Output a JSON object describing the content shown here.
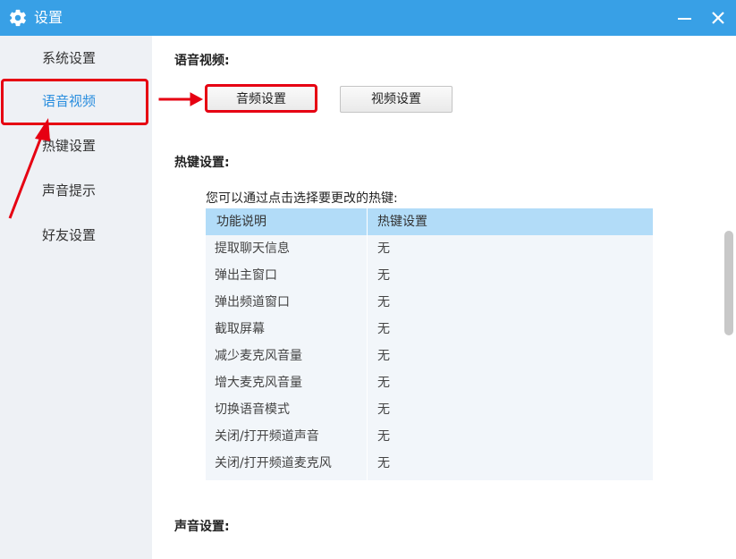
{
  "window": {
    "title": "设置",
    "title_bar_color": "#38a0e6"
  },
  "sidebar": {
    "items": [
      {
        "label": "系统设置",
        "active": false
      },
      {
        "label": "语音视频",
        "active": true
      },
      {
        "label": "热键设置",
        "active": false
      },
      {
        "label": "声音提示",
        "active": false
      },
      {
        "label": "好友设置",
        "active": false
      }
    ]
  },
  "voice_video": {
    "section_title": "语音视频:",
    "audio_button": "音频设置",
    "video_button": "视频设置"
  },
  "hotkeys": {
    "section_title": "热键设置:",
    "hint": "您可以通过点击选择要更改的热键:",
    "columns": [
      "功能说明",
      "热键设置"
    ],
    "rows": [
      {
        "name": "提取聊天信息",
        "key": "无"
      },
      {
        "name": "弹出主窗口",
        "key": "无"
      },
      {
        "name": "弹出频道窗口",
        "key": "无"
      },
      {
        "name": "截取屏幕",
        "key": "无"
      },
      {
        "name": "减少麦克风音量",
        "key": "无"
      },
      {
        "name": "增大麦克风音量",
        "key": "无"
      },
      {
        "name": "切换语音模式",
        "key": "无"
      },
      {
        "name": "关闭/打开频道声音",
        "key": "无"
      },
      {
        "name": "关闭/打开频道麦克风",
        "key": "无"
      }
    ]
  },
  "sound": {
    "section_title": "声音设置:"
  },
  "colors": {
    "accent": "#2a8ede",
    "annotation": "#e60012",
    "table_header": "#b2dcf8",
    "table_body": "#f2f6fa"
  }
}
